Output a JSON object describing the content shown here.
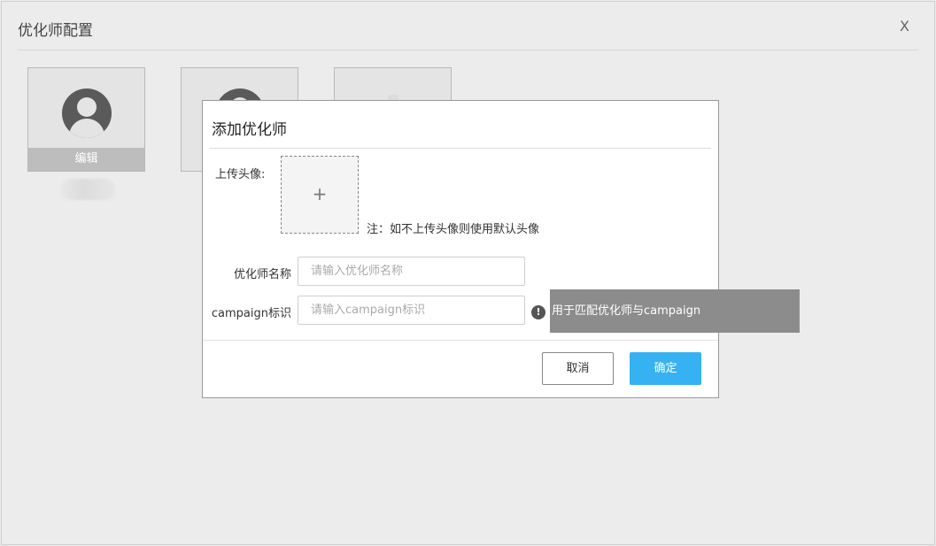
{
  "window": {
    "title": "优化师配置",
    "close_label": "X"
  },
  "cards": [
    {
      "edit_label": "编辑"
    }
  ],
  "dialog": {
    "title": "添加优化师",
    "upload_label": "上传头像:",
    "upload_plus": "+",
    "upload_note": "注：如不上传头像则使用默认头像",
    "name_label": "优化师名称",
    "name_placeholder": "请输入优化师名称",
    "name_value": "",
    "campaign_label": "campaign标识",
    "campaign_placeholder": "请输入campaign标识",
    "campaign_value": "",
    "info_icon_glyph": "!",
    "cancel_label": "取消",
    "ok_label": "确定"
  },
  "tooltip": {
    "text": "用于匹配优化师与campaign"
  },
  "colors": {
    "primary": "#36b2f3",
    "avatar": "#5a5a5a",
    "tooltip_bg": "#8c8c8c"
  }
}
